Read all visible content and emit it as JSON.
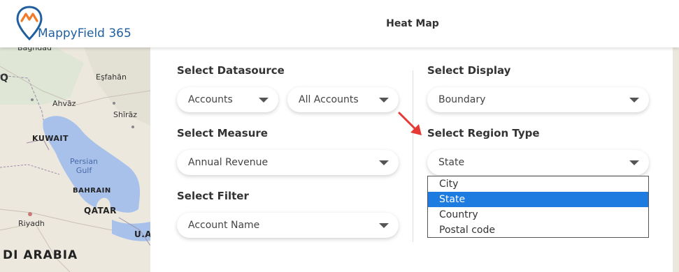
{
  "app": {
    "brand": "MappyField 365",
    "page_title": "Heat Map"
  },
  "map": {
    "labels": {
      "iraq_partial": "Q",
      "baghdad_partial": "Baghdad",
      "esfahan": "Eşfahān",
      "avaz": "Ahvāz",
      "shiraz": "Shīrāz",
      "kuwait": "KUWAIT",
      "persian_gulf": "Persian\nGulf",
      "bahrain": "BAHRAIN",
      "qatar": "QATAR",
      "riyadh": "Riyadh",
      "uae_partial": "U.A",
      "saudi_partial": "DI ARABIA"
    }
  },
  "form": {
    "datasource": {
      "label": "Select Datasource",
      "primary_value": "Accounts",
      "secondary_value": "All Accounts"
    },
    "measure": {
      "label": "Select Measure",
      "value": "Annual Revenue"
    },
    "filter": {
      "label": "Select Filter",
      "value": "Account Name"
    },
    "display": {
      "label": "Select Display",
      "value": "Boundary"
    },
    "region_type": {
      "label": "Select Region Type",
      "value": "State",
      "options": [
        "City",
        "State",
        "Country",
        "Postal code"
      ],
      "selected_index": 1
    }
  },
  "colors": {
    "brand_blue": "#1f5f9f",
    "brand_orange": "#f07c2a",
    "selected_option": "#1e7be0",
    "arrow_red": "#e53935",
    "water": "#a7c1ea"
  }
}
